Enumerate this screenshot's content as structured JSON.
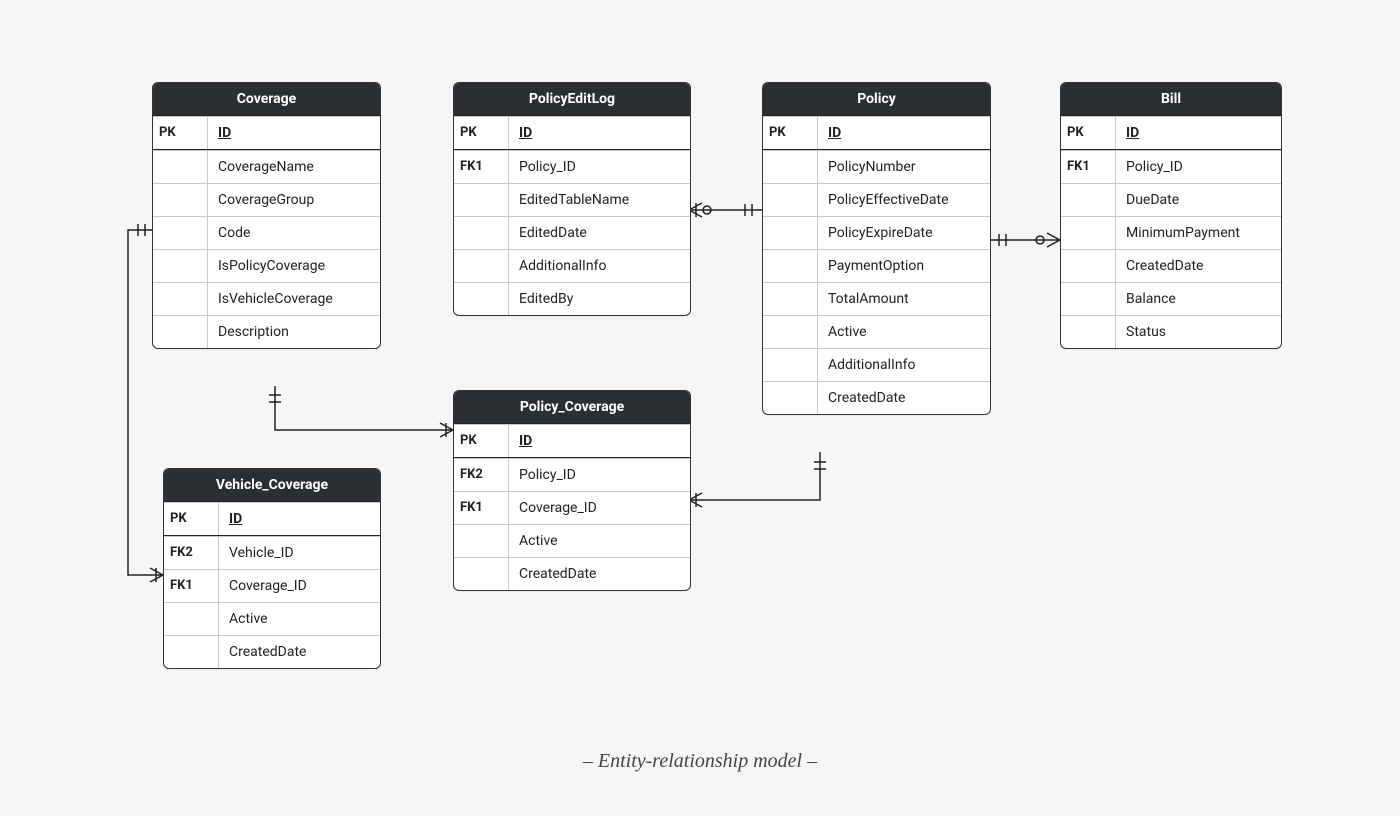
{
  "caption": "– Entity-relationship model –",
  "entities": {
    "coverage": {
      "title": "Coverage",
      "pk_label": "PK",
      "pk_field": "ID",
      "fields": [
        {
          "key": "",
          "name": "CoverageName"
        },
        {
          "key": "",
          "name": "CoverageGroup"
        },
        {
          "key": "",
          "name": "Code"
        },
        {
          "key": "",
          "name": "IsPolicyCoverage"
        },
        {
          "key": "",
          "name": "IsVehicleCoverage"
        },
        {
          "key": "",
          "name": "Description"
        }
      ]
    },
    "policyEditLog": {
      "title": "PolicyEditLog",
      "pk_label": "PK",
      "pk_field": "ID",
      "fields": [
        {
          "key": "FK1",
          "name": "Policy_ID"
        },
        {
          "key": "",
          "name": "EditedTableName"
        },
        {
          "key": "",
          "name": "EditedDate"
        },
        {
          "key": "",
          "name": "AdditionalInfo"
        },
        {
          "key": "",
          "name": "EditedBy"
        }
      ]
    },
    "policy": {
      "title": "Policy",
      "pk_label": "PK",
      "pk_field": "ID",
      "fields": [
        {
          "key": "",
          "name": "PolicyNumber"
        },
        {
          "key": "",
          "name": "PolicyEffectiveDate"
        },
        {
          "key": "",
          "name": "PolicyExpireDate"
        },
        {
          "key": "",
          "name": "PaymentOption"
        },
        {
          "key": "",
          "name": "TotalAmount"
        },
        {
          "key": "",
          "name": "Active"
        },
        {
          "key": "",
          "name": "AdditionalInfo"
        },
        {
          "key": "",
          "name": "CreatedDate"
        }
      ]
    },
    "bill": {
      "title": "Bill",
      "pk_label": "PK",
      "pk_field": "ID",
      "fields": [
        {
          "key": "FK1",
          "name": "Policy_ID"
        },
        {
          "key": "",
          "name": "DueDate"
        },
        {
          "key": "",
          "name": "MinimumPayment"
        },
        {
          "key": "",
          "name": "CreatedDate"
        },
        {
          "key": "",
          "name": "Balance"
        },
        {
          "key": "",
          "name": "Status"
        }
      ]
    },
    "policyCoverage": {
      "title": "Policy_Coverage",
      "pk_label": "PK",
      "pk_field": "ID",
      "fields": [
        {
          "key": "FK2",
          "name": "Policy_ID"
        },
        {
          "key": "FK1",
          "name": "Coverage_ID"
        },
        {
          "key": "",
          "name": "Active"
        },
        {
          "key": "",
          "name": "CreatedDate"
        }
      ]
    },
    "vehicleCoverage": {
      "title": "Vehicle_Coverage",
      "pk_label": "PK",
      "pk_field": "ID",
      "fields": [
        {
          "key": "FK2",
          "name": "Vehicle_ID"
        },
        {
          "key": "FK1",
          "name": "Coverage_ID"
        },
        {
          "key": "",
          "name": "Active"
        },
        {
          "key": "",
          "name": "CreatedDate"
        }
      ]
    }
  },
  "relationships": [
    {
      "from": "Coverage",
      "to": "Vehicle_Coverage",
      "type": "one-to-many"
    },
    {
      "from": "Coverage",
      "to": "Policy_Coverage",
      "type": "one-to-many"
    },
    {
      "from": "Policy",
      "to": "PolicyEditLog",
      "type": "one-to-many"
    },
    {
      "from": "Policy",
      "to": "Policy_Coverage",
      "type": "one-to-many"
    },
    {
      "from": "Policy",
      "to": "Bill",
      "type": "one-to-many"
    }
  ]
}
